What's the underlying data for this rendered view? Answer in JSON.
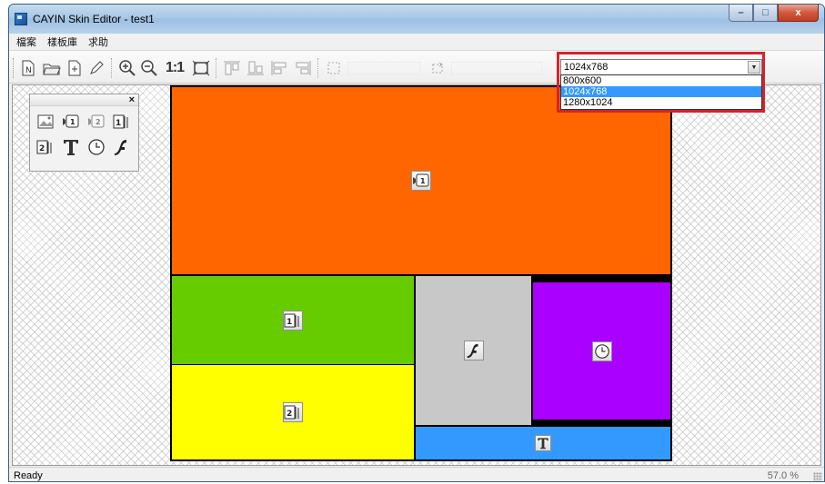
{
  "window": {
    "title": "CAYIN Skin Editor - test1",
    "controls": {
      "minimize": "–",
      "maximize": "□",
      "close": "x"
    }
  },
  "menu": [
    "檔案",
    "樣板庫",
    "求助"
  ],
  "toolbar": {
    "icons": [
      "new-icon",
      "open-icon",
      "save-icon",
      "edit-icon",
      "zoom-in-icon",
      "zoom-out-icon",
      "actual-size-icon",
      "fit-icon",
      "align-top-icon",
      "align-bottom-icon",
      "align-left-icon",
      "align-right-icon",
      "grid-icon",
      "rotate-icon"
    ],
    "actual_size_label": "1:1",
    "resolution": {
      "selected": "1024x768",
      "options": [
        "800x600",
        "1024x768",
        "1280x1024"
      ]
    }
  },
  "palette": {
    "close": "×",
    "tools": [
      "image-zone-icon",
      "video1-zone-icon",
      "video2-zone-icon",
      "media1-zone-icon",
      "media2-zone-icon",
      "text-zone-icon",
      "clock-zone-icon",
      "flash-zone-icon"
    ]
  },
  "zones": [
    {
      "name": "video-zone",
      "color": "#ff6600",
      "icon": "video1-zone-icon"
    },
    {
      "name": "media1-zone",
      "color": "#66cc00",
      "icon": "media1-zone-icon"
    },
    {
      "name": "media2-zone",
      "color": "#ffff00",
      "icon": "media2-zone-icon"
    },
    {
      "name": "flash-zone",
      "color": "#c8c8c8",
      "icon": "flash-zone-icon"
    },
    {
      "name": "clock-zone",
      "color": "#aa00ff",
      "icon": "clock-zone-icon"
    },
    {
      "name": "text-zone",
      "color": "#3399ff",
      "icon": "text-zone-icon"
    }
  ],
  "status": {
    "text": "Ready",
    "zoom": "57.0 %"
  }
}
